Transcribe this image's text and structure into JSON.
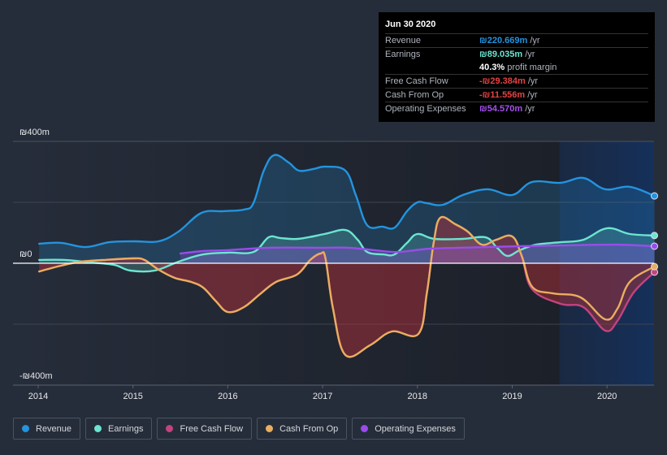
{
  "tooltip": {
    "date": "Jun 30 2020",
    "rows": [
      {
        "label": "Revenue",
        "value": "₪220.669m",
        "unit": " /yr",
        "color": "#2394df"
      },
      {
        "label": "Earnings",
        "value": "₪89.035m",
        "unit": " /yr",
        "color": "#6ce5d0"
      },
      {
        "label": "",
        "value": "40.3%",
        "unit": " profit margin",
        "color": "#ffffff"
      },
      {
        "label": "Free Cash Flow",
        "value": "-₪29.384m",
        "unit": " /yr",
        "color": "#e64242"
      },
      {
        "label": "Cash From Op",
        "value": "-₪11.556m",
        "unit": " /yr",
        "color": "#e64242"
      },
      {
        "label": "Operating Expenses",
        "value": "₪54.570m",
        "unit": " /yr",
        "color": "#a651f0"
      }
    ]
  },
  "legend": [
    {
      "label": "Revenue",
      "color": "#2394df"
    },
    {
      "label": "Earnings",
      "color": "#6ce5d0"
    },
    {
      "label": "Free Cash Flow",
      "color": "#c4427f"
    },
    {
      "label": "Cash From Op",
      "color": "#e9ae5f"
    },
    {
      "label": "Operating Expenses",
      "color": "#9a4cea"
    }
  ],
  "chart_data": {
    "type": "area",
    "title": "",
    "xlabel": "",
    "ylabel": "",
    "currency": "₪",
    "ylim": [
      -400,
      400
    ],
    "xlim": [
      2013.95,
      2020.5
    ],
    "y_ticks": [
      {
        "value": 400,
        "label": "₪400m"
      },
      {
        "value": 0,
        "label": "₪0"
      },
      {
        "value": -400,
        "label": "-₪400m"
      }
    ],
    "x_ticks": [
      {
        "value": 2014,
        "label": "2014"
      },
      {
        "value": 2015,
        "label": "2015"
      },
      {
        "value": 2016,
        "label": "2016"
      },
      {
        "value": 2017,
        "label": "2017"
      },
      {
        "value": 2018,
        "label": "2018"
      },
      {
        "value": 2019,
        "label": "2019"
      },
      {
        "value": 2020,
        "label": "2020"
      }
    ],
    "highlight_range": [
      2019.5,
      2020.5
    ],
    "grid": true,
    "series": [
      {
        "name": "Revenue",
        "color": "#2394df",
        "fill": true,
        "x": [
          2014.01,
          2014.24,
          2014.5,
          2014.75,
          2015.01,
          2015.27,
          2015.48,
          2015.72,
          2015.95,
          2016.17,
          2016.27,
          2016.38,
          2016.49,
          2016.64,
          2016.75,
          2016.9,
          2017.03,
          2017.24,
          2017.35,
          2017.47,
          2017.63,
          2017.76,
          2017.89,
          2018.0,
          2018.1,
          2018.27,
          2018.48,
          2018.74,
          2019.0,
          2019.21,
          2019.51,
          2019.75,
          2019.98,
          2020.24,
          2020.5
        ],
        "y": [
          64,
          67,
          53,
          69,
          72,
          72,
          104,
          165,
          171,
          176,
          197,
          304,
          355,
          331,
          304,
          309,
          317,
          304,
          224,
          125,
          120,
          117,
          171,
          200,
          197,
          192,
          224,
          243,
          224,
          267,
          264,
          280,
          243,
          251,
          221
        ]
      },
      {
        "name": "Earnings",
        "color": "#6ce5d0",
        "fill": true,
        "x": [
          2014.01,
          2014.28,
          2014.54,
          2014.8,
          2014.97,
          2015.23,
          2015.48,
          2015.74,
          2016.0,
          2016.27,
          2016.43,
          2016.55,
          2016.74,
          2017.02,
          2017.24,
          2017.37,
          2017.47,
          2017.64,
          2017.76,
          2017.89,
          2018.0,
          2018.18,
          2018.48,
          2018.72,
          2018.84,
          2018.95,
          2019.08,
          2019.25,
          2019.51,
          2019.75,
          2020.0,
          2020.24,
          2020.5
        ],
        "y": [
          11,
          11,
          3,
          -5,
          -24,
          -24,
          5,
          29,
          35,
          37,
          85,
          83,
          80,
          96,
          109,
          77,
          37,
          29,
          29,
          67,
          96,
          80,
          80,
          85,
          51,
          24,
          43,
          61,
          69,
          77,
          115,
          96,
          91
        ]
      },
      {
        "name": "Free Cash Flow",
        "color": "#c4427f",
        "fill": true,
        "x": [
          2014.01,
          2014.24,
          2014.45,
          2014.71,
          2015.01,
          2015.12,
          2015.27,
          2015.44,
          2015.61,
          2015.74,
          2015.87,
          2016.0,
          2016.17,
          2016.34,
          2016.51,
          2016.73,
          2016.87,
          2016.98,
          2017.03,
          2017.11,
          2017.24,
          2017.5,
          2017.73,
          2018.01,
          2018.1,
          2018.17,
          2018.24,
          2018.4,
          2018.53,
          2018.68,
          2018.83,
          2019.0,
          2019.1,
          2019.21,
          2019.51,
          2019.75,
          2019.98,
          2020.11,
          2020.28,
          2020.5
        ],
        "y": [
          -27,
          -8,
          5,
          11,
          16,
          11,
          -21,
          -48,
          -61,
          -80,
          -123,
          -160,
          -144,
          -101,
          -61,
          -37,
          11,
          32,
          16,
          -149,
          -301,
          -269,
          -224,
          -232,
          -96,
          64,
          149,
          128,
          104,
          61,
          77,
          88,
          24,
          -85,
          -133,
          -144,
          -221,
          -189,
          -96,
          -29
        ]
      },
      {
        "name": "Cash From Op",
        "color": "#e9ae5f",
        "fill": false,
        "x": [
          2014.01,
          2014.24,
          2014.45,
          2014.71,
          2015.01,
          2015.12,
          2015.27,
          2015.44,
          2015.61,
          2015.74,
          2015.87,
          2016.0,
          2016.17,
          2016.34,
          2016.51,
          2016.73,
          2016.87,
          2016.98,
          2017.03,
          2017.11,
          2017.24,
          2017.5,
          2017.73,
          2018.01,
          2018.1,
          2018.17,
          2018.24,
          2018.4,
          2018.53,
          2018.68,
          2018.83,
          2019.0,
          2019.1,
          2019.21,
          2019.43,
          2019.72,
          2019.98,
          2020.11,
          2020.24,
          2020.5
        ],
        "y": [
          -27,
          -8,
          5,
          11,
          16,
          11,
          -21,
          -48,
          -61,
          -80,
          -123,
          -160,
          -144,
          -101,
          -61,
          -37,
          11,
          32,
          16,
          -149,
          -301,
          -269,
          -224,
          -232,
          -96,
          64,
          149,
          128,
          104,
          61,
          77,
          88,
          24,
          -77,
          -99,
          -112,
          -184,
          -149,
          -61,
          -11
        ]
      },
      {
        "name": "Operating Expenses",
        "color": "#9a4cea",
        "fill": true,
        "x": [
          2015.5,
          2015.74,
          2016.0,
          2016.43,
          2017.02,
          2017.28,
          2017.54,
          2017.8,
          2018.14,
          2018.74,
          2019.08,
          2019.6,
          2020.11,
          2020.5
        ],
        "y": [
          32,
          40,
          43,
          51,
          51,
          51,
          43,
          37,
          48,
          53,
          56,
          59,
          61,
          56
        ]
      }
    ]
  }
}
